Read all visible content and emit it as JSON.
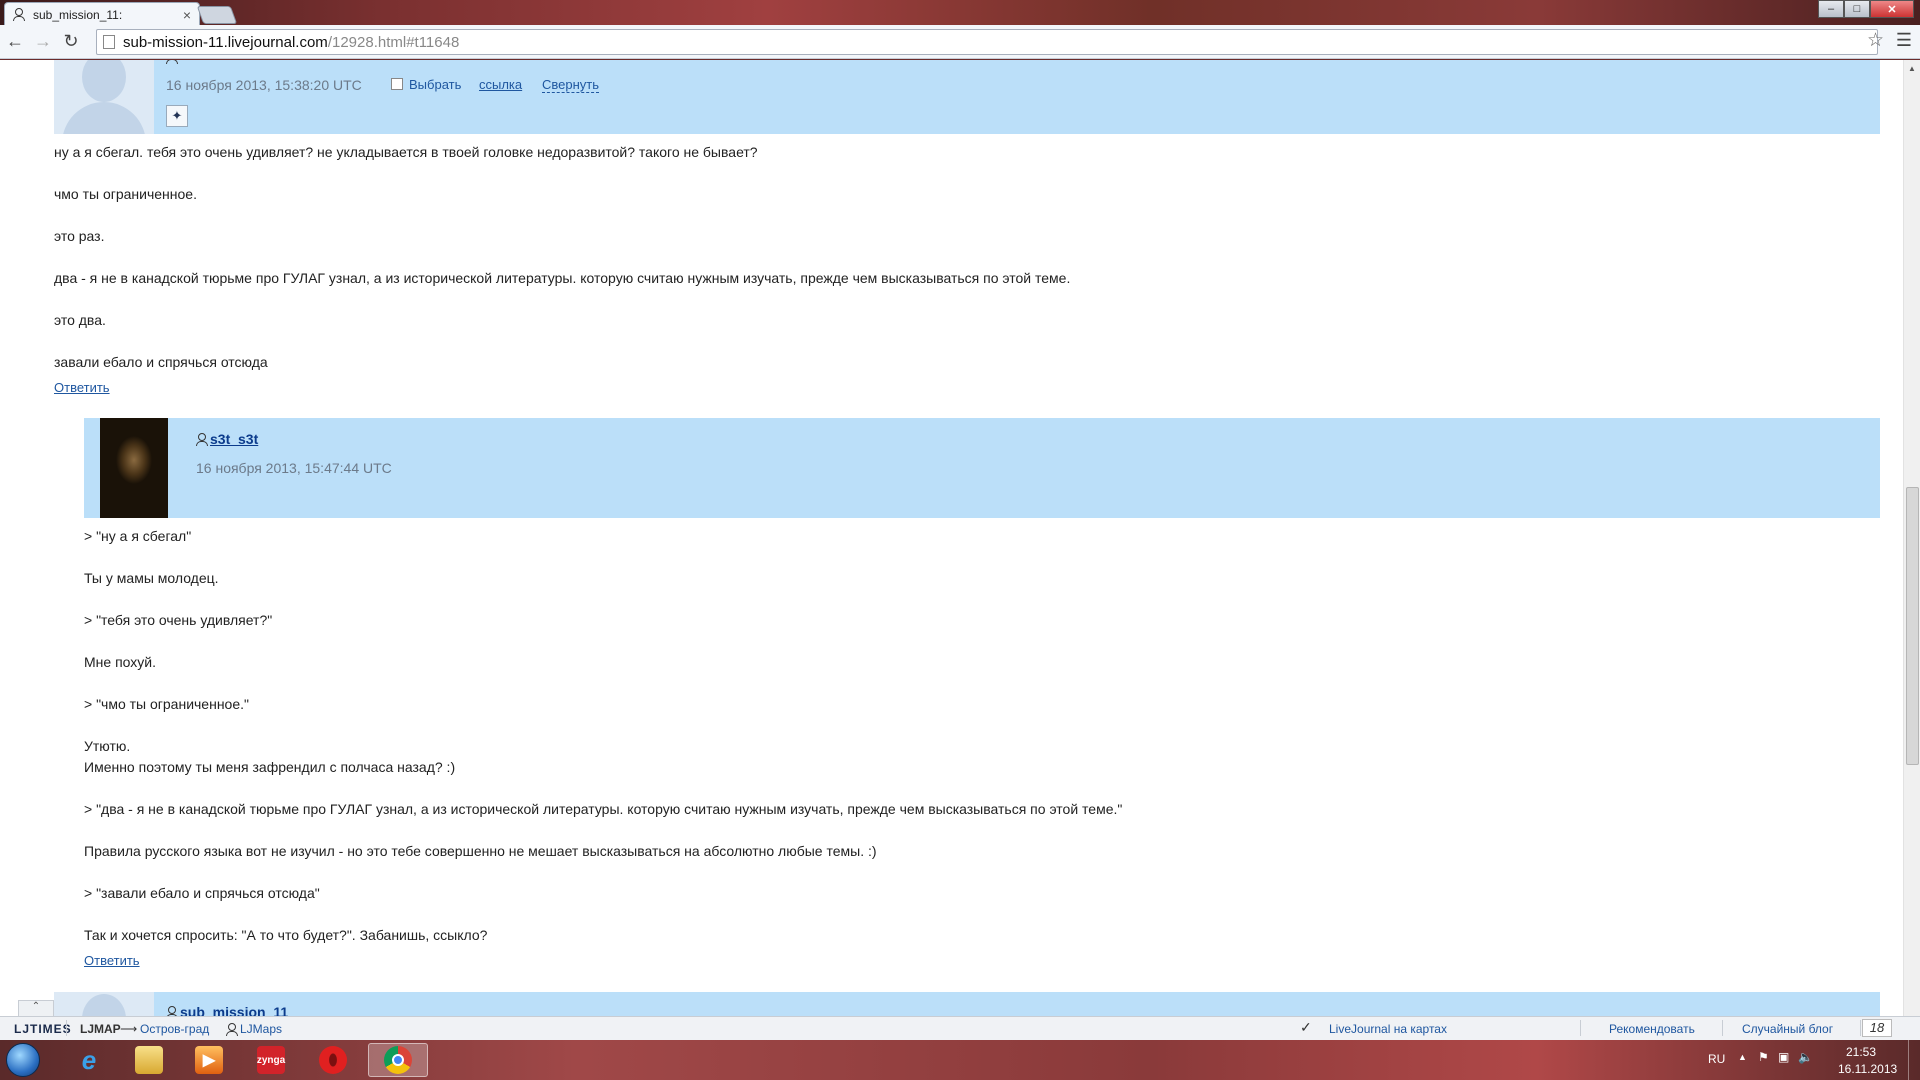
{
  "browser": {
    "tab_title": "sub_mission_11:",
    "tab_close": "×",
    "url_host": "sub-mission-11.livejournal.com",
    "url_path": "/12928.html#t11648",
    "controls": {
      "minimize": "–",
      "maximize": "□",
      "close": "✕"
    }
  },
  "comments": [
    {
      "username": "",
      "date": "16 ноября 2013, 15:38:20 UTC",
      "select_label": "Выбрать",
      "link_label": "ссылка",
      "collapse_label": "Свернуть",
      "lines": [
        "ну а я сбегал. тебя это очень удивляет? не укладывается в твоей головке недоразвитой? такого не бывает?",
        "чмо ты ограниченное.",
        "это раз.",
        "два - я не в канадской тюрьме про ГУЛАГ узнал, а из исторической литературы. которую считаю нужным изучать, прежде чем высказываться по этой теме.",
        "это два.",
        "завали ебало и спрячься отсюда"
      ],
      "reply_label": "Ответить"
    },
    {
      "username": "s3t_s3t",
      "date": "16 ноября 2013, 15:47:44 UTC",
      "lines": [
        "> \"ну а я сбегал\"",
        "Ты у мамы молодец.",
        "> \"тебя это очень удивляет?\"",
        "Мне похуй.",
        "> \"чмо ты ограниченное.\"",
        "Утютю.",
        "Именно поэтому ты меня зафрендил с полчаса назад? :)",
        "> \"два - я не в канадской тюрьме про ГУЛАГ узнал, а из исторической литературы. которую считаю нужным изучать, прежде чем высказываться по этой теме.\"",
        "Правила русского языка вот не изучил - но это тебе совершенно не мешает высказываться на абсолютно любые темы. :)",
        "> \"завали ебало и спрячься отсюда\"",
        "Так и хочется спросить: \"А то что будет?\". Забанишь, ссыкло?"
      ],
      "reply_label": "Ответить"
    },
    {
      "username": "sub_mission_11"
    }
  ],
  "ljbar": {
    "logo": "LJTIMES",
    "ljmap": "LJMAP",
    "arrow": "⟶",
    "island": "Остров-град",
    "ljmaps": "LJMaps",
    "lj_on_maps": "LiveJournal на картах",
    "recommend": "Рекомендовать",
    "random_blog": "Случайный блог",
    "count": "18"
  },
  "taskbar": {
    "lang": "RU",
    "time": "21:53",
    "date": "16.11.2013",
    "zynga": "zynga"
  }
}
